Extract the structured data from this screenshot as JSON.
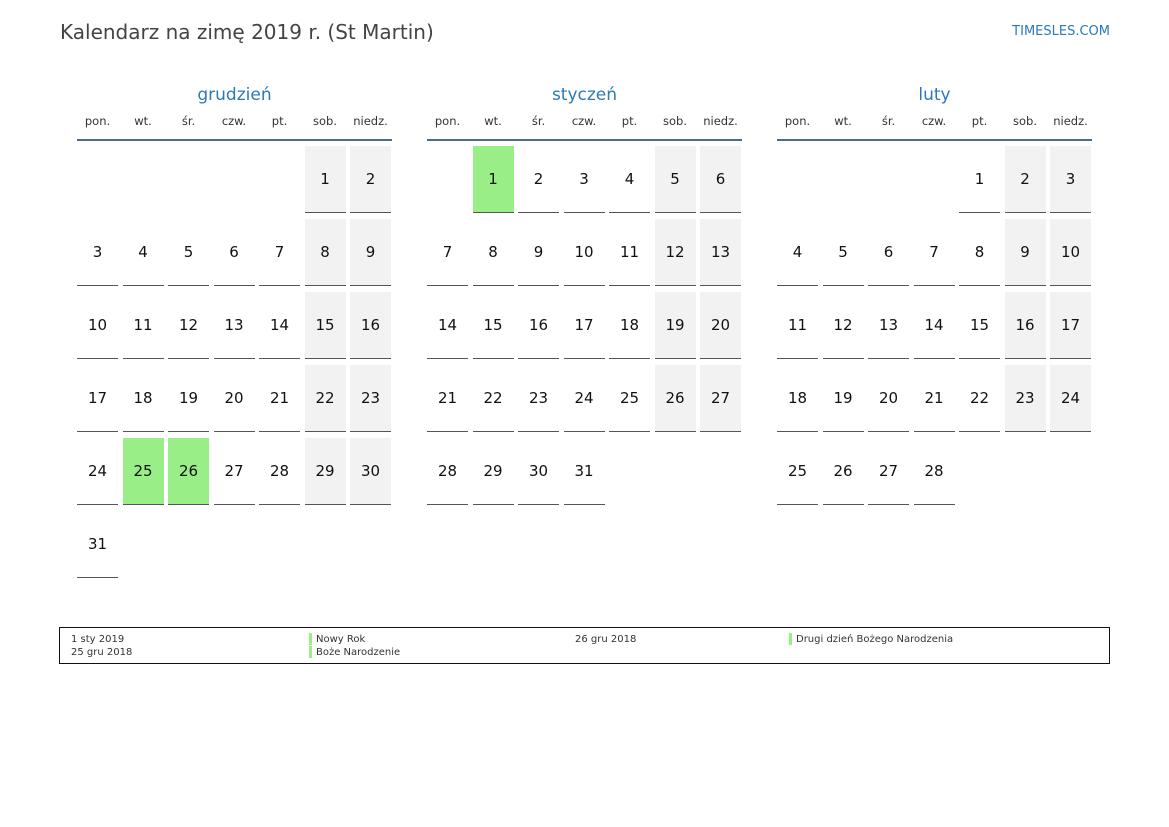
{
  "header": {
    "title": "Kalendarz na zimę 2019 r. (St Martin)",
    "site": "TIMESLES.COM"
  },
  "months": [
    {
      "name": "grudzień",
      "dow": [
        "pon.",
        "wt.",
        "śr.",
        "czw.",
        "pt.",
        "sob.",
        "niedz."
      ],
      "weeks": [
        [
          "",
          "",
          "",
          "",
          "",
          "1",
          "2"
        ],
        [
          "3",
          "4",
          "5",
          "6",
          "7",
          "8",
          "9"
        ],
        [
          "10",
          "11",
          "12",
          "13",
          "14",
          "15",
          "16"
        ],
        [
          "17",
          "18",
          "19",
          "20",
          "21",
          "22",
          "23"
        ],
        [
          "24",
          "25",
          "26",
          "27",
          "28",
          "29",
          "30"
        ],
        [
          "31",
          "",
          "",
          "",
          "",
          "",
          ""
        ]
      ],
      "holidays": [
        "25",
        "26"
      ]
    },
    {
      "name": "styczeń",
      "dow": [
        "pon.",
        "wt.",
        "śr.",
        "czw.",
        "pt.",
        "sob.",
        "niedz."
      ],
      "weeks": [
        [
          "",
          "1",
          "2",
          "3",
          "4",
          "5",
          "6"
        ],
        [
          "7",
          "8",
          "9",
          "10",
          "11",
          "12",
          "13"
        ],
        [
          "14",
          "15",
          "16",
          "17",
          "18",
          "19",
          "20"
        ],
        [
          "21",
          "22",
          "23",
          "24",
          "25",
          "26",
          "27"
        ],
        [
          "28",
          "29",
          "30",
          "31",
          "",
          "",
          ""
        ]
      ],
      "holidays": [
        "1"
      ]
    },
    {
      "name": "luty",
      "dow": [
        "pon.",
        "wt.",
        "śr.",
        "czw.",
        "pt.",
        "sob.",
        "niedz."
      ],
      "weeks": [
        [
          "",
          "",
          "",
          "",
          "1",
          "2",
          "3"
        ],
        [
          "4",
          "5",
          "6",
          "7",
          "8",
          "9",
          "10"
        ],
        [
          "11",
          "12",
          "13",
          "14",
          "15",
          "16",
          "17"
        ],
        [
          "18",
          "19",
          "20",
          "21",
          "22",
          "23",
          "24"
        ],
        [
          "25",
          "26",
          "27",
          "28",
          "",
          "",
          ""
        ]
      ],
      "holidays": []
    }
  ],
  "legend": [
    {
      "date": "1 sty 2019",
      "name": "Nowy Rok"
    },
    {
      "date": "25 gru 2018",
      "name": "Boże Narodzenie"
    },
    {
      "date": "26 gru 2018",
      "name": "Drugi dzień Bożego Narodzenia"
    }
  ],
  "colors": {
    "accent": "#2a7ab8",
    "holiday": "#99ee88",
    "weekend": "#f2f2f2",
    "rule": "#4a6a8f"
  }
}
